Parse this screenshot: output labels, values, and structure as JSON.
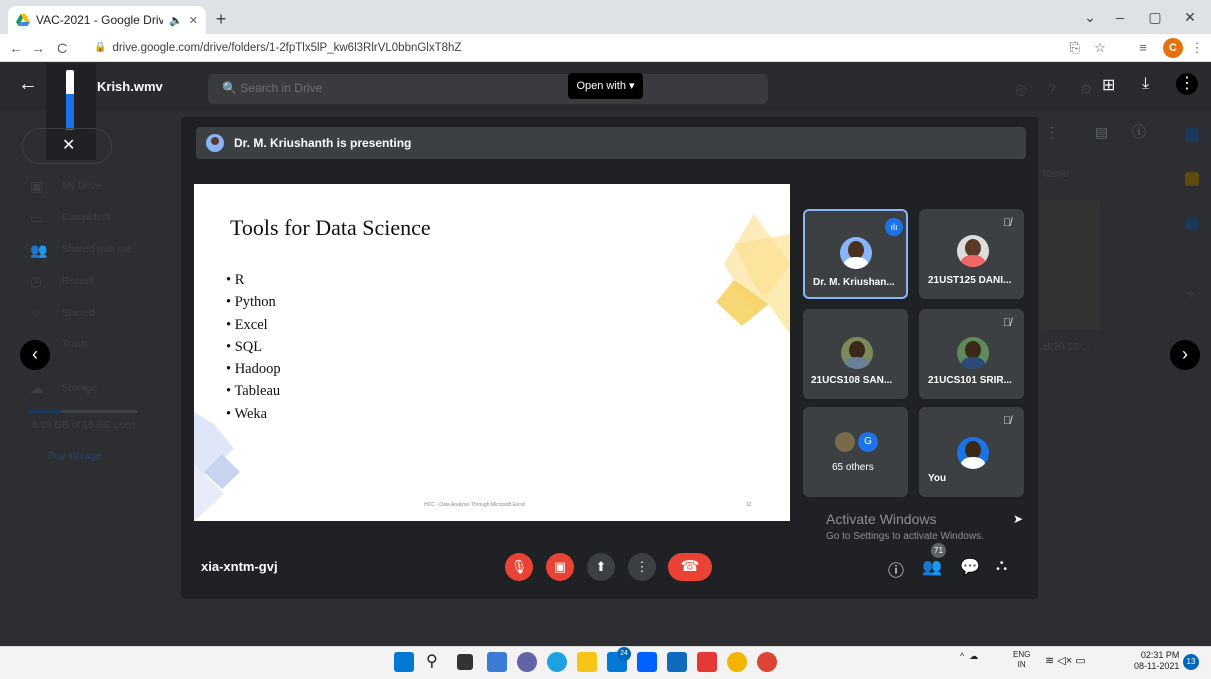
{
  "browser": {
    "tab_title": "VAC-2021 - Google Drive",
    "url": "drive.google.com/drive/folders/1-2fpTlx5lP_kw6l3RlrVL0bbnGlxT8hZ",
    "profile_initial": "C"
  },
  "drive": {
    "file_name": "Krish.wmv",
    "search_placeholder": "Search in Drive",
    "open_with": "Open with",
    "sidebar": [
      "My Drive",
      "Computers",
      "Shared with me",
      "Recent",
      "Starred",
      "Trash",
      "Storage"
    ],
    "storage_used": "6.69 GB of 15 GB used",
    "buy_storage": "Buy storage",
    "sort_label": "Name",
    "file_partial": "al(20-10-..."
  },
  "meet": {
    "presenting": "Dr. M. Kriushanth is presenting",
    "meeting_code": "xia-xntm-gvj",
    "participant_count": "71",
    "tiles": [
      {
        "name": "Dr. M. Kriushan...",
        "speaking": true
      },
      {
        "name": "21UST125 DANI...",
        "muted": true
      },
      {
        "name": "21UCS108 SAN..."
      },
      {
        "name": "21UCS101 SRIR...",
        "muted": true
      },
      {
        "name": "65 others",
        "badge": "G"
      },
      {
        "name": "You",
        "muted": true
      }
    ],
    "activate_title": "Activate Windows",
    "activate_sub": "Go to Settings to activate Windows."
  },
  "slide": {
    "title": "Tools for Data Science",
    "bullets": [
      "R",
      "Python",
      "Excel",
      "SQL",
      "Hadoop",
      "Tableau",
      "Weka"
    ],
    "footer": "HCC - Data Analysis Through Microsoft Excel",
    "page": "12"
  },
  "taskbar": {
    "language": "ENG",
    "region": "IN",
    "time": "02:31 PM",
    "date": "08-11-2021",
    "notifications": "13",
    "badge": "24"
  }
}
